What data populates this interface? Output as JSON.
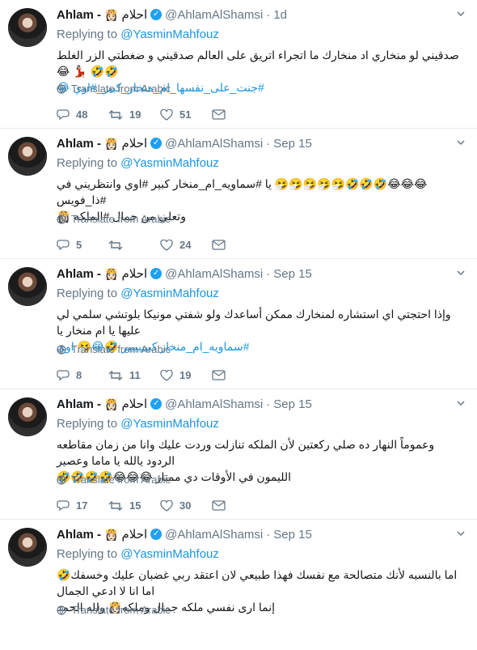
{
  "tweets": [
    {
      "name": "Ahlam -",
      "emoji": "👸🏻",
      "arabic_name": "احلام",
      "handle": "@AhlamAlShamsi",
      "time": "1d",
      "replying_label": "Replying to",
      "replying_to": "@YasminMahfouz",
      "text_plain": "صدقيني لو منخاري اد منخارك ما اتجراء اتريق على العالم صدقيني و ضغطتي الزر الغلط 🤣🤣 💃🏻 😂",
      "text_tag": "#جنت_على_نفسها_ام_منخار_كبير_#اوي 😂",
      "translate": "Translate from Arabic",
      "replies": "48",
      "retweets": "19",
      "likes": "51"
    },
    {
      "name": "Ahlam -",
      "emoji": "👸🏻",
      "arabic_name": "احلام",
      "handle": "@AhlamAlShamsi",
      "time": "Sep 15",
      "replying_label": "Replying to",
      "replying_to": "@YasminMahfouz",
      "text_plain": "😂😂😂🤣🤣🤣🤧🤧🤧🤧🤧 يا #سماويه_ام_منخار كبير #اوي وانتظريني في #ذا_فويس",
      "text_tag": "وتعلي من جمال #الملكه 👸🏻",
      "translate": "Translate from Arabic",
      "replies": "5",
      "retweets": "",
      "likes": "24"
    },
    {
      "name": "Ahlam -",
      "emoji": "👸🏻",
      "arabic_name": "احلام",
      "handle": "@AhlamAlShamsi",
      "time": "Sep 15",
      "replying_label": "Replying to",
      "replying_to": "@YasminMahfouz",
      "text_plain": "وإذا احتجتي اي استشاره لمنخارك ممكن أساعدك ولو شفتي مونيكا بلوتشي سلمي لي عليها يا ام منخار يا",
      "text_tag": "#سماويه_ام_منخار كبيييييير 🤣😂🤧 اوي",
      "translate": "Translate from Arabic",
      "replies": "8",
      "retweets": "11",
      "likes": "19"
    },
    {
      "name": "Ahlam -",
      "emoji": "👸🏻",
      "arabic_name": "احلام",
      "handle": "@AhlamAlShamsi",
      "time": "Sep 15",
      "replying_label": "Replying to",
      "replying_to": "@YasminMahfouz",
      "text_plain": "وعموماً النهار ده صلي ركعتين لأن الملكه تنازلت وردت عليك وانا من زمان مقاطعه الردود يالله يا ماما وعصير",
      "text_tag": "الليمون في الأوقات دي ممتاز 😂😂😂🤣🤣🤣🤣",
      "translate": "Translate from Arabic",
      "replies": "17",
      "retweets": "15",
      "likes": "30"
    },
    {
      "name": "Ahlam -",
      "emoji": "👸🏻",
      "arabic_name": "احلام",
      "handle": "@AhlamAlShamsi",
      "time": "Sep 15",
      "replying_label": "Replying to",
      "replying_to": "@YasminMahfouz",
      "text_plain": "اما بالنسبه لأنك متصالحة مع نفسك فهذا طبيعي لان اعتقد ربي غضبان عليك وخسفك🤣 اما انا لا ادعي الجمال",
      "text_tag": "إنما ارى نفسي ملكه جمال وملكه👸🏻 ولله الحمد",
      "translate": "Translate from Arabic",
      "replies": "",
      "retweets": "",
      "likes": ""
    }
  ]
}
